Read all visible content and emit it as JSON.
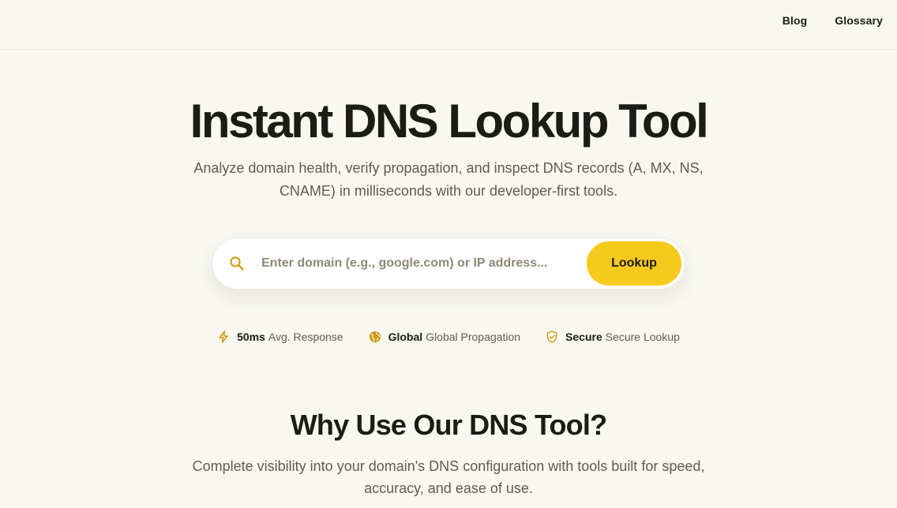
{
  "nav": {
    "links": [
      {
        "label": "Blog"
      },
      {
        "label": "Glossary"
      }
    ]
  },
  "hero": {
    "title": "Instant DNS Lookup Tool",
    "subtitle": "Analyze domain health, verify propagation, and inspect DNS records (A, MX, NS, CNAME) in milliseconds with our developer-first tools."
  },
  "search": {
    "placeholder": "Enter domain (e.g., google.com) or IP address...",
    "value": "",
    "button_label": "Lookup",
    "icon": "search-icon"
  },
  "stats": [
    {
      "icon": "lightning-icon",
      "value": "50ms",
      "label": "Avg. Response"
    },
    {
      "icon": "globe-icon",
      "value": "Global",
      "label": "Global Propagation"
    },
    {
      "icon": "shield-check-icon",
      "value": "Secure",
      "label": "Secure Lookup"
    }
  ],
  "why": {
    "title": "Why Use Our DNS Tool?",
    "subtitle": "Complete visibility into your domain's DNS configuration with tools built for speed, accuracy, and ease of use."
  },
  "colors": {
    "background": "#f8f7f1",
    "accent": "#f6c91d",
    "icon_accent": "#c99a08",
    "text": "#1c1c17",
    "muted_text": "#5f5c50"
  }
}
